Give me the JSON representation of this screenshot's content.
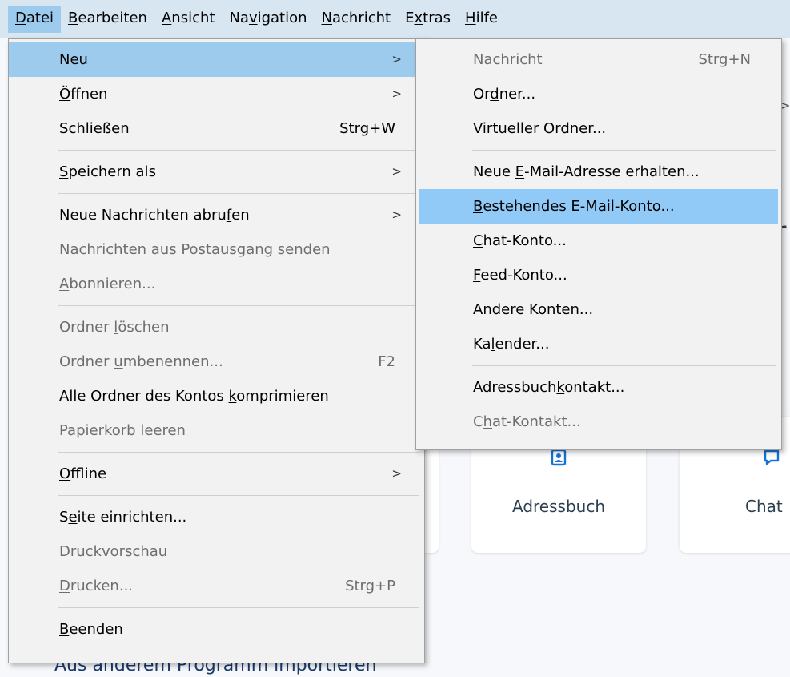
{
  "menubar": [
    {
      "pre": "",
      "u": "D",
      "post": "atei",
      "active": true
    },
    {
      "pre": "",
      "u": "B",
      "post": "earbeiten",
      "active": false
    },
    {
      "pre": "",
      "u": "A",
      "post": "nsicht",
      "active": false
    },
    {
      "pre": "Na",
      "u": "v",
      "post": "igation",
      "active": false
    },
    {
      "pre": "",
      "u": "N",
      "post": "achricht",
      "active": false
    },
    {
      "pre": "E",
      "u": "x",
      "post": "tras",
      "active": false
    },
    {
      "pre": "",
      "u": "H",
      "post": "ilfe",
      "active": false
    }
  ],
  "file_menu": [
    {
      "pre": "",
      "u": "N",
      "post": "eu",
      "arrow": true,
      "hl": true,
      "disabled": false
    },
    {
      "pre": "",
      "u": "Ö",
      "post": "ffnen",
      "arrow": true,
      "disabled": false
    },
    {
      "pre": "S",
      "u": "c",
      "post": "hließen",
      "shortcut": "Strg+W",
      "disabled": false
    },
    {
      "sep": true
    },
    {
      "pre": "",
      "u": "S",
      "post": "peichern als",
      "arrow": true,
      "disabled": false
    },
    {
      "sep": true
    },
    {
      "pre": "Neue Nachrichten abru",
      "u": "f",
      "post": "en",
      "arrow": true,
      "disabled": false
    },
    {
      "pre": "Nachrichten aus ",
      "u": "P",
      "post": "ostausgang senden",
      "disabled": true
    },
    {
      "pre": "",
      "u": "A",
      "post": "bonnieren...",
      "disabled": true
    },
    {
      "sep": true
    },
    {
      "pre": "Ordner ",
      "u": "l",
      "post": "öschen",
      "disabled": true
    },
    {
      "pre": "Ordner ",
      "u": "u",
      "post": "mbenennen...",
      "shortcut": "F2",
      "disabled": true
    },
    {
      "pre": "Alle Ordner des Kontos ",
      "u": "k",
      "post": "omprimieren",
      "disabled": false
    },
    {
      "pre": "Papie",
      "u": "r",
      "post": "korb leeren",
      "disabled": true
    },
    {
      "sep": true
    },
    {
      "pre": "",
      "u": "O",
      "post": "ffline",
      "arrow": true,
      "disabled": false
    },
    {
      "sep": true
    },
    {
      "pre": "S",
      "u": "e",
      "post": "ite einrichten...",
      "disabled": false
    },
    {
      "pre": "Druck",
      "u": "v",
      "post": "orschau",
      "disabled": true
    },
    {
      "pre": "",
      "u": "D",
      "post": "rucken...",
      "shortcut": "Strg+P",
      "disabled": true
    },
    {
      "sep": true
    },
    {
      "pre": "",
      "u": "B",
      "post": "eenden",
      "disabled": false
    }
  ],
  "submenu_new": [
    {
      "pre": "",
      "u": "N",
      "post": "achricht",
      "shortcut": "Strg+N",
      "disabled": true
    },
    {
      "pre": "Or",
      "u": "d",
      "post": "ner...",
      "disabled": false
    },
    {
      "pre": "",
      "u": "V",
      "post": "irtueller Ordner...",
      "disabled": false
    },
    {
      "sep": true
    },
    {
      "pre": "Neue ",
      "u": "E",
      "post": "-Mail-Adresse erhalten...",
      "disabled": false
    },
    {
      "pre": "",
      "u": "B",
      "post": "estehendes E-Mail-Konto...",
      "hl": true,
      "disabled": false
    },
    {
      "pre": "",
      "u": "C",
      "post": "hat-Konto...",
      "disabled": false
    },
    {
      "pre": "",
      "u": "F",
      "post": "eed-Konto...",
      "disabled": false
    },
    {
      "pre": "Andere K",
      "u": "o",
      "post": "nten...",
      "disabled": false
    },
    {
      "pre": "Ka",
      "u": "l",
      "post": "ender...",
      "disabled": false
    },
    {
      "sep": true
    },
    {
      "pre": "Adressbuch",
      "u": "k",
      "post": "ontakt...",
      "disabled": false
    },
    {
      "pre": "C",
      "u": "h",
      "post": "at-Kontakt...",
      "disabled": true
    }
  ],
  "background": {
    "card_addressbook_label": "Adressbuch",
    "card_chat_label": "Chat",
    "partial_heading_char": "r",
    "partial_arrow_char": ">",
    "import_link": "Aus anderem Programm importieren"
  },
  "icons": {
    "addressbook": "addressbook-icon",
    "chat": "chat-bubble-icon",
    "submenu": "chevron-right-icon"
  },
  "colors": {
    "menubar_bg": "#d8e6f2",
    "highlight": "#9ccbed",
    "menu_bg": "#f2f2f2",
    "accent_icon": "#1373d9"
  }
}
